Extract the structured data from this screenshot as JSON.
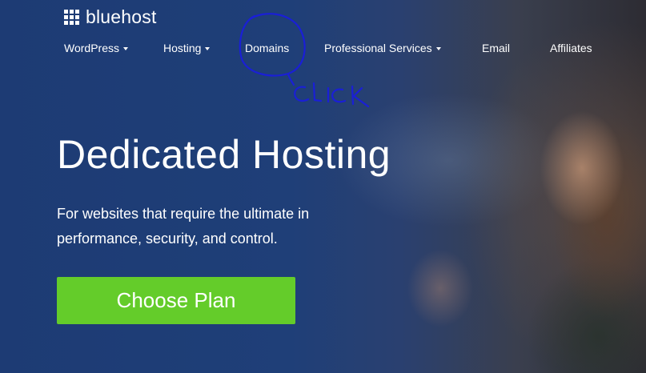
{
  "brand": {
    "name": "bluehost"
  },
  "nav": {
    "items": [
      {
        "label": "WordPress",
        "dropdown": true
      },
      {
        "label": "Hosting",
        "dropdown": true
      },
      {
        "label": "Domains",
        "dropdown": false
      },
      {
        "label": "Professional Services",
        "dropdown": true
      },
      {
        "label": "Email",
        "dropdown": false
      },
      {
        "label": "Affiliates",
        "dropdown": false
      }
    ]
  },
  "hero": {
    "title": "Dedicated Hosting",
    "subtitle": "For websites that require the ultimate in performance, security, and control.",
    "cta_label": "Choose Plan"
  },
  "annotation": {
    "text": "Click",
    "color": "#1a1fd6"
  },
  "colors": {
    "cta": "#64cc2a",
    "background": "#1d3b74"
  }
}
